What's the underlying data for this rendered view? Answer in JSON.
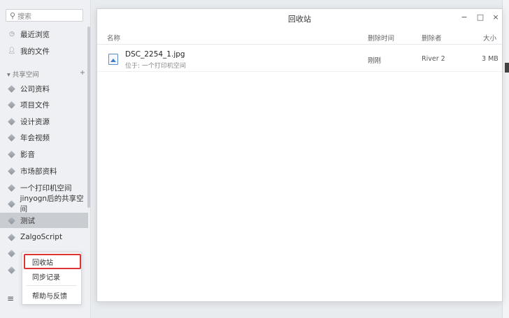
{
  "sidebar": {
    "search_placeholder": "搜索",
    "top_items": [
      {
        "label": "最近浏览"
      },
      {
        "label": "我的文件"
      }
    ],
    "section_label": "共享空间",
    "section_add": "+",
    "spaces": [
      {
        "label": "公司资料"
      },
      {
        "label": "项目文件"
      },
      {
        "label": "设计资源"
      },
      {
        "label": "年会视频"
      },
      {
        "label": "影音"
      },
      {
        "label": "市场部资料"
      },
      {
        "label": "一个打印机空间"
      },
      {
        "label": "jinyogn后的共享空间"
      },
      {
        "label": "测试"
      },
      {
        "label": "ZalgoScript"
      }
    ],
    "menu_glyph": "≡"
  },
  "context_menu": {
    "items": [
      {
        "label": "回收站"
      },
      {
        "label": "同步记录"
      },
      {
        "label": "帮助与反馈"
      }
    ]
  },
  "window": {
    "title": "回收站",
    "controls": {
      "minimize": "−",
      "maximize": "□",
      "close": "×"
    },
    "columns": {
      "name": "名称",
      "deleted_time": "删除时间",
      "deleted_by": "删除者",
      "size": "大小"
    },
    "rows": [
      {
        "name": "DSC_2254_1.jpg",
        "location": "位于: 一个打印机空间",
        "deleted_time": "刚刚",
        "deleted_by": "River 2",
        "size": "3 MB"
      }
    ]
  }
}
